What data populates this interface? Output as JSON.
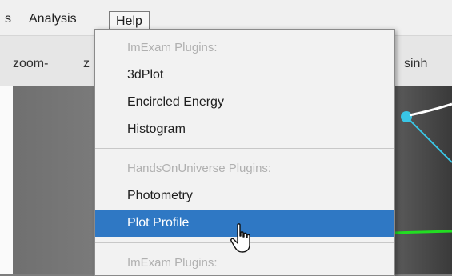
{
  "menubar": {
    "partial_left": "s",
    "analysis": "Analysis",
    "help": "Help"
  },
  "toolbar": {
    "zoom_minus": "zoom-",
    "partial_z": "z",
    "sinh": "sinh"
  },
  "menu": {
    "header1": "ImExam Plugins:",
    "item_3dplot": "3dPlot",
    "item_encircled": "Encircled Energy",
    "item_histogram": "Histogram",
    "header2": "HandsOnUniverse Plugins:",
    "item_photometry": "Photometry",
    "item_plotprofile": "Plot Profile",
    "header3": "ImExam Plugins:"
  },
  "colors": {
    "selection": "#2f78c4",
    "plot_line_cyan": "#39c6e6",
    "plot_line_green": "#22dd22"
  },
  "icons": {
    "cursor": "hand-pointer-icon"
  }
}
